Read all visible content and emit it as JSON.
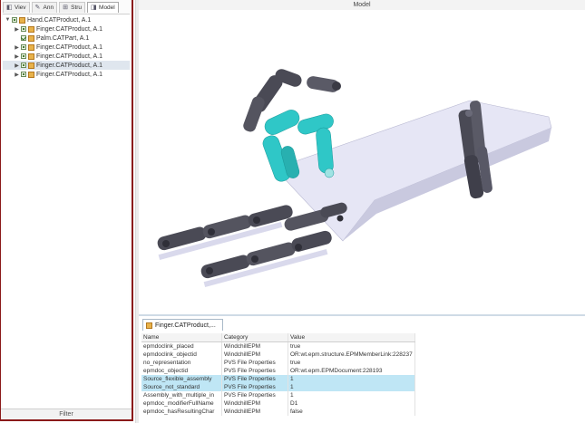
{
  "left_tabs": [
    {
      "label": "Viev",
      "icon": "view-icon"
    },
    {
      "label": "Ann",
      "icon": "annotation-icon"
    },
    {
      "label": "Stru",
      "icon": "structure-icon"
    },
    {
      "label": "Model",
      "icon": "model-icon"
    }
  ],
  "tree": [
    {
      "label": "Hand.CATProduct, A.1",
      "expander": "▼",
      "checked": false,
      "level": 0
    },
    {
      "label": "Finger.CATProduct, A.1",
      "expander": "▶",
      "checked": false,
      "level": 1
    },
    {
      "label": "Palm.CATPart, A.1",
      "expander": "",
      "checked": true,
      "level": 1
    },
    {
      "label": "Finger.CATProduct, A.1",
      "expander": "▶",
      "checked": false,
      "level": 1
    },
    {
      "label": "Finger.CATProduct, A.1",
      "expander": "▶",
      "checked": false,
      "level": 1
    },
    {
      "label": "Finger.CATProduct, A.1",
      "expander": "▶",
      "checked": false,
      "level": 1,
      "selected": true
    },
    {
      "label": "Finger.CATProduct, A.1",
      "expander": "▶",
      "checked": false,
      "level": 1
    }
  ],
  "filter_label": "Filter",
  "model_title": "Model",
  "props_tab_label": "Finger.CATProduct,...",
  "props_columns": [
    "Name",
    "Category",
    "Value"
  ],
  "props_rows": [
    [
      "epmdoclink_placed",
      "WindchillEPM",
      "true"
    ],
    [
      "epmdoclink_objectid",
      "WindchillEPM",
      "OR:wt.epm.structure.EPMMemberLink:228237"
    ],
    [
      "no_representation",
      "PVS File Properties",
      "true"
    ],
    [
      "epmdoc_objectid",
      "PVS File Properties",
      "OR:wt.epm.EPMDocument:228193"
    ],
    [
      "Source_flexible_assembly",
      "PVS File Properties",
      "1"
    ],
    [
      "Source_not_standard",
      "PVS File Properties",
      "1"
    ],
    [
      "Assembly_with_multiple_in",
      "PVS File Properties",
      "1"
    ],
    [
      "epmdoc_modifierFullName",
      "WindchillEPM",
      "D1"
    ],
    [
      "epmdoc_hasResultingChar",
      "WindchillEPM",
      "false"
    ]
  ],
  "highlight_rows": [
    4,
    5
  ],
  "colors": {
    "panel_border": "#8b1a1a",
    "highlight": "#bfe6f5",
    "finger_selected": "#2fc7c7",
    "palm": "#e6e6f5",
    "joint": "#4a4a55"
  }
}
